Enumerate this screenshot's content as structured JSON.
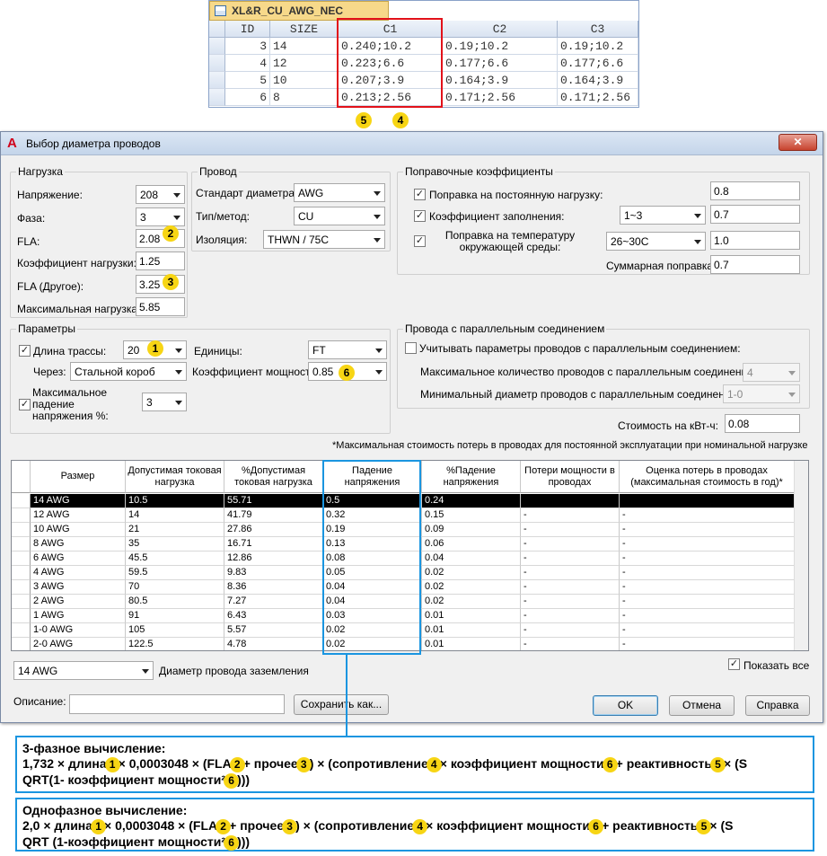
{
  "access_table": {
    "tab_title": "XL&R_CU_AWG_NEC",
    "headers": [
      "ID",
      "SIZE",
      "C1",
      "C2",
      "C3"
    ],
    "rows": [
      [
        "3",
        "14",
        "0.240;10.2",
        "0.19;10.2",
        "0.19;10.2"
      ],
      [
        "4",
        "12",
        "0.223;6.6",
        "0.177;6.6",
        "0.177;6.6"
      ],
      [
        "5",
        "10",
        "0.207;3.9",
        "0.164;3.9",
        "0.164;3.9"
      ],
      [
        "6",
        "8",
        "0.213;2.56",
        "0.171;2.56",
        "0.171;2.56"
      ]
    ],
    "badge_left": "5",
    "badge_right": "4"
  },
  "dialog": {
    "title": "Выбор диаметра проводов",
    "close_label": "✕",
    "load": {
      "legend": "Нагрузка",
      "voltage_label": "Напряжение:",
      "voltage_value": "208",
      "phase_label": "Фаза:",
      "phase_value": "3",
      "fla_label": "FLA:",
      "fla_value": "2.08",
      "fla_badge": "2",
      "load_factor_label": "Коэффициент нагрузки:",
      "load_factor_value": "1.25",
      "fla_other_label": "FLA (Другое):",
      "fla_other_value": "3.25",
      "fla_other_badge": "3",
      "max_load_label": "Максимальная нагрузка:",
      "max_load_value": "5.85"
    },
    "wire": {
      "legend": "Провод",
      "standard_label": "Стандарт диаметра:",
      "standard_value": "AWG",
      "type_label": "Тип/метод:",
      "type_value": "CU",
      "insulation_label": "Изоляция:",
      "insulation_value": "THWN / 75C"
    },
    "correction": {
      "legend": "Поправочные коэффициенты",
      "continuous_label": "Поправка на постоянную нагрузку:",
      "continuous_value": "0.8",
      "fill_label": "Коэффициент заполнения:",
      "fill_select": "1~3",
      "fill_value": "0.7",
      "ambient_label": "Поправка на температуру окружающей среды:",
      "ambient_select": "26~30C",
      "ambient_value": "1.0",
      "total_label": "Суммарная поправка:",
      "total_value": "0.7"
    },
    "params": {
      "legend": "Параметры",
      "run_length_label": "Длина трассы:",
      "run_length_value": "20",
      "run_length_badge": "1",
      "units_label": "Единицы:",
      "units_value": "FT",
      "via_label": "Через:",
      "via_value": "Стальной короб",
      "power_factor_label": "Коэффициент мощности:",
      "power_factor_value": "0.85",
      "power_factor_badge": "6",
      "max_drop_label": "Максимальное падение напряжения %:",
      "max_drop_value": "3"
    },
    "parallel": {
      "legend": "Провода с параллельным соединением",
      "consider_label": "Учитывать параметры проводов с параллельным соединением:",
      "max_count_label": "Максимальное количество проводов с параллельным соединением:",
      "max_count_value": "4",
      "min_size_label": "Минимальный диаметр проводов с параллельным соединением:",
      "min_size_value": "1-0"
    },
    "cost_label": "Стоимость на кВт-ч:",
    "cost_value": "0.08",
    "note": "*Максимальная стоимость потерь в проводах для постоянной эксплуатации при номинальной нагрузке",
    "grid": {
      "headers": [
        "Размер",
        "Допустимая токовая нагрузка",
        "%Допустимая токовая нагрузка",
        "Падение напряжения",
        "%Падение напряжения",
        "Потери мощности в проводах",
        "Оценка потерь в проводах (максимальная стоимость в год)*"
      ],
      "rows": [
        [
          "14 AWG",
          "10.5",
          "55.71",
          "0.5",
          "0.24",
          "",
          ""
        ],
        [
          "12 AWG",
          "14",
          "41.79",
          "0.32",
          "0.15",
          "-",
          "-"
        ],
        [
          "10 AWG",
          "21",
          "27.86",
          "0.19",
          "0.09",
          "-",
          "-"
        ],
        [
          "8 AWG",
          "35",
          "16.71",
          "0.13",
          "0.06",
          "-",
          "-"
        ],
        [
          "6 AWG",
          "45.5",
          "12.86",
          "0.08",
          "0.04",
          "-",
          "-"
        ],
        [
          "4 AWG",
          "59.5",
          "9.83",
          "0.05",
          "0.02",
          "-",
          "-"
        ],
        [
          "3 AWG",
          "70",
          "8.36",
          "0.04",
          "0.02",
          "-",
          "-"
        ],
        [
          "2 AWG",
          "80.5",
          "7.27",
          "0.04",
          "0.02",
          "-",
          "-"
        ],
        [
          "1 AWG",
          "91",
          "6.43",
          "0.03",
          "0.01",
          "-",
          "-"
        ],
        [
          "1-0 AWG",
          "105",
          "5.57",
          "0.02",
          "0.01",
          "-",
          "-"
        ],
        [
          "2-0 AWG",
          "122.5",
          "4.78",
          "0.02",
          "0.01",
          "-",
          "-"
        ]
      ]
    },
    "ground_select": "14 AWG",
    "ground_label": "Диаметр провода заземления",
    "show_all_label": "Показать все",
    "description_label": "Описание:",
    "save_as_label": "Сохранить как...",
    "ok_label": "OK",
    "cancel_label": "Отмена",
    "help_label": "Справка"
  },
  "formula3": {
    "title": "3-фазное вычисление:",
    "parts": [
      "1,732 × длина",
      "1",
      "× 0,0003048 × (FLA",
      "2",
      "+ прочее",
      "3",
      ") × (сопротивление",
      "4",
      "× коэффициент мощности",
      "6",
      "+ реактивность",
      "5",
      "× (S"
    ],
    "line2": [
      "QRT(1-  коэффициент мощности²",
      "6",
      ")))"
    ]
  },
  "formula1": {
    "title": "Однофазное вычисление:",
    "parts": [
      "2,0 × длина",
      "1",
      "× 0,0003048 ×  (FLA",
      "2",
      "+ прочее",
      "3",
      ") × (сопротивление",
      "4",
      "× коэффициент мощности",
      "6",
      "+ реактивность",
      "5",
      "× (S"
    ],
    "line2": [
      "QRT (1-коэффициент мощности²",
      "6",
      ")))"
    ]
  }
}
